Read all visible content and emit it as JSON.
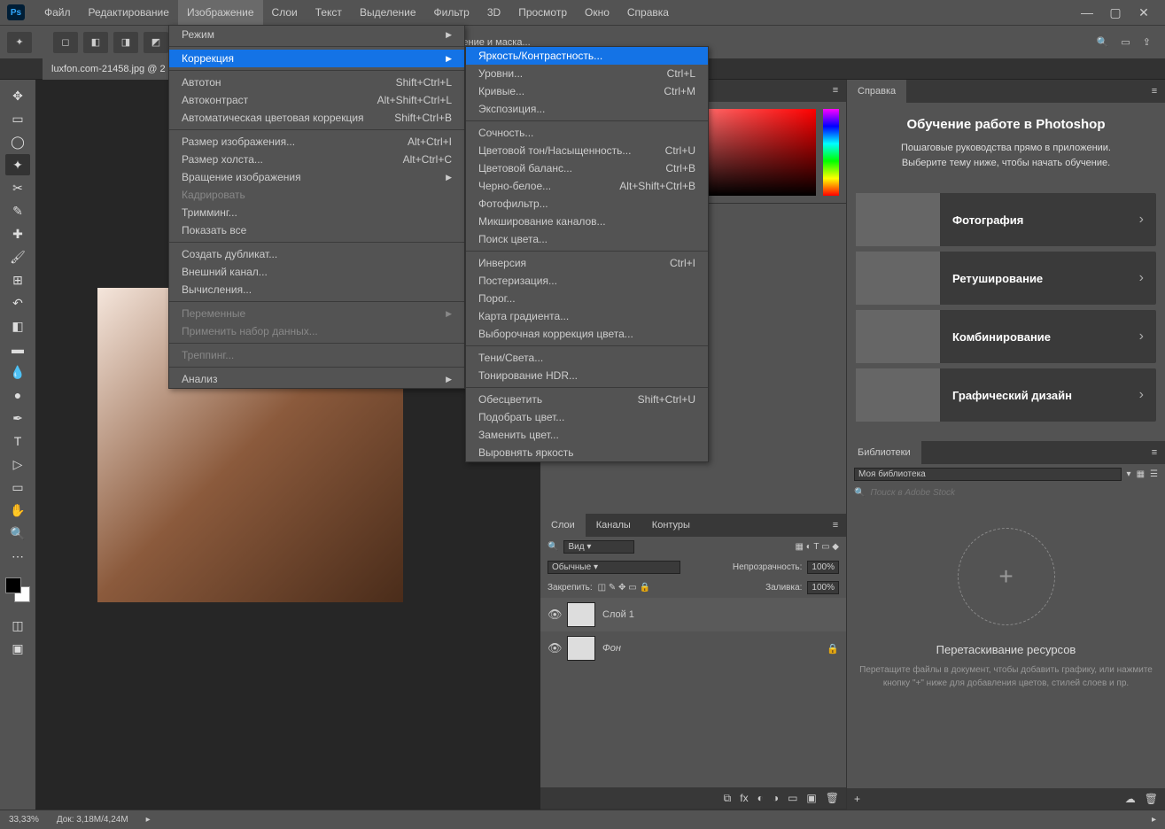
{
  "menubar": {
    "items": [
      "Файл",
      "Редактирование",
      "Изображение",
      "Слои",
      "Текст",
      "Выделение",
      "Фильтр",
      "3D",
      "Просмотр",
      "Окно",
      "Справка"
    ],
    "active_index": 2
  },
  "doc_tab": "luxfon.com-21458.jpg @ 2",
  "options_right_text": "ление и маска...",
  "image_menu": [
    {
      "label": "Режим",
      "submenu": true
    },
    "---",
    {
      "label": "Коррекция",
      "submenu": true,
      "highlight": true
    },
    "---",
    {
      "label": "Автотон",
      "shortcut": "Shift+Ctrl+L"
    },
    {
      "label": "Автоконтраст",
      "shortcut": "Alt+Shift+Ctrl+L"
    },
    {
      "label": "Автоматическая цветовая коррекция",
      "shortcut": "Shift+Ctrl+B"
    },
    "---",
    {
      "label": "Размер изображения...",
      "shortcut": "Alt+Ctrl+I"
    },
    {
      "label": "Размер холста...",
      "shortcut": "Alt+Ctrl+C"
    },
    {
      "label": "Вращение изображения",
      "submenu": true
    },
    {
      "label": "Кадрировать",
      "disabled": true
    },
    {
      "label": "Тримминг..."
    },
    {
      "label": "Показать все"
    },
    "---",
    {
      "label": "Создать дубликат..."
    },
    {
      "label": "Внешний канал..."
    },
    {
      "label": "Вычисления..."
    },
    "---",
    {
      "label": "Переменные",
      "submenu": true,
      "disabled": true
    },
    {
      "label": "Применить набор данных...",
      "disabled": true
    },
    "---",
    {
      "label": "Треппинг...",
      "disabled": true
    },
    "---",
    {
      "label": "Анализ",
      "submenu": true
    }
  ],
  "correction_submenu": [
    {
      "label": "Яркость/Контрастность...",
      "highlight": true
    },
    {
      "label": "Уровни...",
      "shortcut": "Ctrl+L"
    },
    {
      "label": "Кривые...",
      "shortcut": "Ctrl+M"
    },
    {
      "label": "Экспозиция..."
    },
    "---",
    {
      "label": "Сочность..."
    },
    {
      "label": "Цветовой тон/Насыщенность...",
      "shortcut": "Ctrl+U"
    },
    {
      "label": "Цветовой баланс...",
      "shortcut": "Ctrl+B"
    },
    {
      "label": "Черно-белое...",
      "shortcut": "Alt+Shift+Ctrl+B"
    },
    {
      "label": "Фотофильтр..."
    },
    {
      "label": "Микширование каналов..."
    },
    {
      "label": "Поиск цвета..."
    },
    "---",
    {
      "label": "Инверсия",
      "shortcut": "Ctrl+I"
    },
    {
      "label": "Постеризация..."
    },
    {
      "label": "Порог..."
    },
    {
      "label": "Карта градиента..."
    },
    {
      "label": "Выборочная коррекция цвета..."
    },
    "---",
    {
      "label": "Тени/Света..."
    },
    {
      "label": "Тонирование HDR..."
    },
    "---",
    {
      "label": "Обесцветить",
      "shortcut": "Shift+Ctrl+U"
    },
    {
      "label": "Подобрать цвет..."
    },
    {
      "label": "Заменить цвет..."
    },
    {
      "label": "Выровнять яркость"
    }
  ],
  "layers": {
    "tabs": [
      "Слои",
      "Каналы",
      "Контуры"
    ],
    "filter_label": "Вид",
    "blend": "Обычные",
    "opacity_label": "Непрозрачность:",
    "opacity": "100%",
    "lock_label": "Закрепить:",
    "fill_label": "Заливка:",
    "fill": "100%",
    "items": [
      {
        "name": "Слой 1",
        "selected": true
      },
      {
        "name": "Фон",
        "locked": true
      }
    ]
  },
  "help": {
    "tab": "Справка",
    "title": "Обучение работе в Photoshop",
    "sub1": "Пошаговые руководства прямо в приложении.",
    "sub2": "Выберите тему ниже, чтобы начать обучение.",
    "cards": [
      "Фотография",
      "Ретуширование",
      "Комбинирование",
      "Графический дизайн"
    ]
  },
  "libraries": {
    "tab": "Библиотеки",
    "select": "Моя библиотека",
    "search_placeholder": "Поиск в Adobe Stock",
    "drop_title": "Перетаскивание ресурсов",
    "drop_desc": "Перетащите файлы в документ, чтобы добавить графику, или нажмите кнопку \"+\" ниже для добавления цветов, стилей слоев и пр."
  },
  "status": {
    "zoom": "33,33%",
    "doc": "Док: 3,18M/4,24M"
  }
}
